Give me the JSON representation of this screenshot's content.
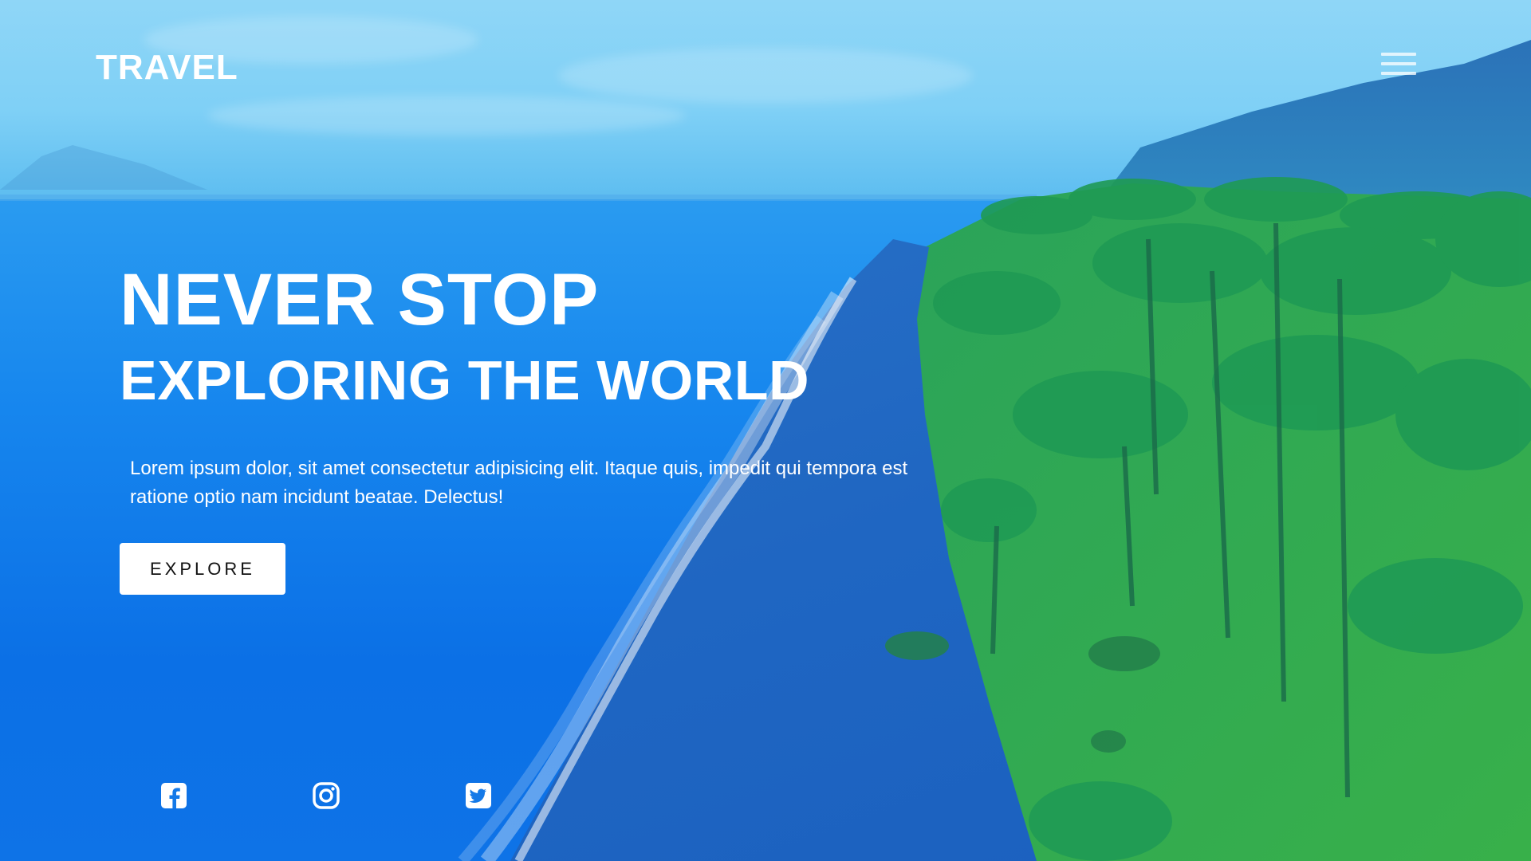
{
  "header": {
    "logo": "TRAVEL",
    "menu_icon": "hamburger-menu-icon"
  },
  "hero": {
    "headline": "NEVER STOP",
    "subheadline": "EXPLORING THE WORLD",
    "description": "Lorem ipsum dolor, sit amet consectetur adipisicing elit. Itaque quis, impedit qui tempora est ratione optio nam incidunt beatae. Delectus!",
    "cta_label": "EXPLORE"
  },
  "social": [
    {
      "icon": "facebook-icon"
    },
    {
      "icon": "instagram-icon"
    },
    {
      "icon": "twitter-icon"
    }
  ],
  "colors": {
    "text": "#ffffff",
    "button_bg": "#ffffff",
    "button_text": "#111111",
    "sea": "#0f6de8",
    "sky": "#7fd0f6",
    "foliage": "#2aa35a"
  }
}
